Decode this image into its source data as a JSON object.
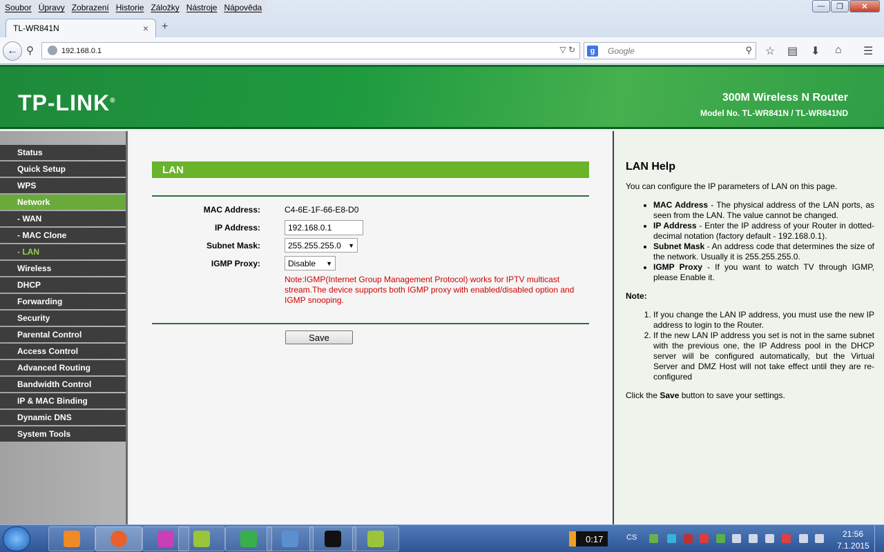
{
  "menubar": [
    "Soubor",
    "Úpravy",
    "Zobrazení",
    "Historie",
    "Záložky",
    "Nástroje",
    "Nápověda"
  ],
  "tab": {
    "title": "TL-WR841N",
    "close": "×",
    "new_tab": "+"
  },
  "address": {
    "url": "192.168.0.1"
  },
  "search": {
    "placeholder": "Google"
  },
  "header": {
    "logo": "TP-LINK",
    "product": "300M Wireless N Router",
    "model": "Model No. TL-WR841N / TL-WR841ND"
  },
  "nav": {
    "items": [
      {
        "label": "Status"
      },
      {
        "label": "Quick Setup"
      },
      {
        "label": "WPS"
      },
      {
        "label": "Network"
      },
      {
        "label": "- WAN"
      },
      {
        "label": "- MAC Clone"
      },
      {
        "label": "- LAN"
      },
      {
        "label": "Wireless"
      },
      {
        "label": "DHCP"
      },
      {
        "label": "Forwarding"
      },
      {
        "label": "Security"
      },
      {
        "label": "Parental Control"
      },
      {
        "label": "Access Control"
      },
      {
        "label": "Advanced Routing"
      },
      {
        "label": "Bandwidth Control"
      },
      {
        "label": "IP & MAC Binding"
      },
      {
        "label": "Dynamic DNS"
      },
      {
        "label": "System Tools"
      }
    ]
  },
  "main": {
    "title": "LAN",
    "mac_label": "MAC Address:",
    "mac_value": "C4-6E-1F-66-E8-D0",
    "ip_label": "IP Address:",
    "ip_value": "192.168.0.1",
    "subnet_label": "Subnet Mask:",
    "subnet_value": "255.255.255.0",
    "igmp_label": "IGMP Proxy:",
    "igmp_value": "Disable",
    "note": "Note:IGMP(Internet Group Management Protocol) works for IPTV multicast stream.The device supports both IGMP proxy with enabled/disabled option and IGMP snooping.",
    "save_label": "Save"
  },
  "help": {
    "title": "LAN Help",
    "intro": "You can configure the IP parameters of LAN on this page.",
    "items": [
      {
        "term": "MAC Address",
        "desc": " - The physical address of the LAN ports, as seen from the LAN. The value cannot be changed."
      },
      {
        "term": "IP Address",
        "desc": " - Enter the IP address of your Router in dotted-decimal notation (factory default - 192.168.0.1)."
      },
      {
        "term": "Subnet Mask",
        "desc": " - An address code that determines the size of the network. Usually it is 255.255.255.0."
      },
      {
        "term": "IGMP Proxy",
        "desc": " - If you want to watch TV through IGMP, please Enable it."
      }
    ],
    "note_label": "Note:",
    "notes": [
      "If you change the LAN IP address, you must use the new IP address to login to the Router.",
      "If the new LAN IP address you set is not in the same subnet with the previous one, the IP Address pool in the DHCP server will be configured automatically, but the Virtual Server and DMZ Host will not take effect until they are re-configured"
    ],
    "footer_pre": "Click the ",
    "footer_bold": "Save",
    "footer_post": " button to save your settings."
  },
  "taskbar": {
    "timer": "0:17",
    "lang": "CS",
    "time": "21:56",
    "date": "7.1.2015"
  }
}
